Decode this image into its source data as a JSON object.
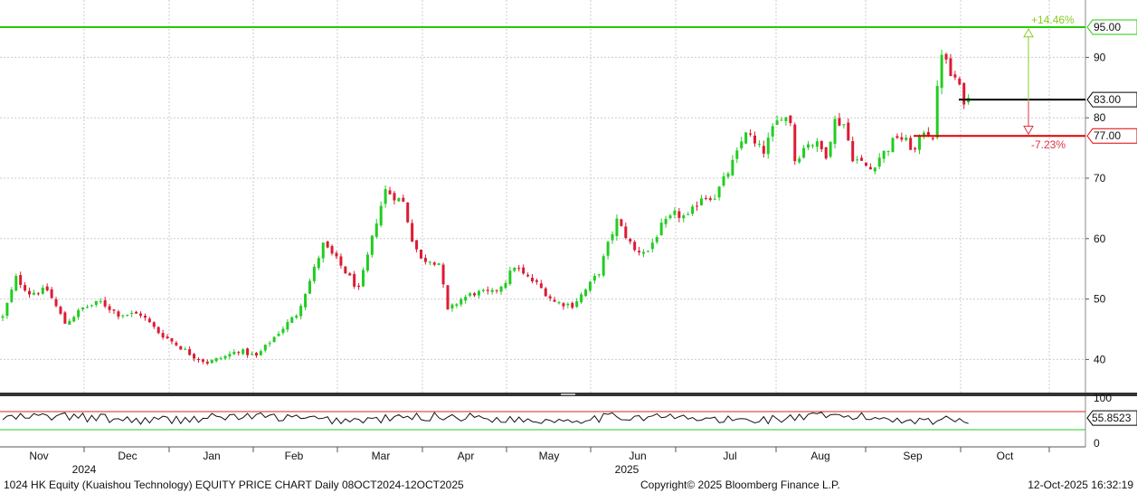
{
  "chart_data": {
    "type": "candlestick",
    "title": "1024 HK Equity (Kuaishou Technology) EQUITY PRICE CHART Daily 08OCT2024-12OCT2025",
    "x_range": [
      "2024-10-08",
      "2025-10-12"
    ],
    "price_axis": {
      "ylim": [
        33.5,
        97
      ],
      "ticks": [
        40,
        50,
        60,
        70,
        80,
        90
      ]
    },
    "x_tick_labels": [
      "Nov",
      "Dec",
      "Jan",
      "Feb",
      "Mar",
      "Apr",
      "May",
      "Jun",
      "Jul",
      "Aug",
      "Sep",
      "Oct"
    ],
    "year_labels": [
      "2024",
      "2025"
    ],
    "grid": true,
    "levels": {
      "upper_target": {
        "value": 95.0,
        "label": "95.00",
        "color": "#22cc00"
      },
      "last_price": {
        "value": 83.0,
        "label": "83.00",
        "color": "#000000"
      },
      "lower_target": {
        "value": 77.0,
        "label": "77.00",
        "color": "#dd0000"
      }
    },
    "annotations": {
      "upside_pct": "+14.46%",
      "downside_pct": "-7.23%"
    },
    "anchors": [
      [
        0,
        47
      ],
      [
        3,
        53.5
      ],
      [
        6,
        51
      ],
      [
        10,
        51.5
      ],
      [
        14,
        46
      ],
      [
        18,
        48.5
      ],
      [
        22,
        49.5
      ],
      [
        26,
        47.5
      ],
      [
        31,
        47.5
      ],
      [
        35,
        44.5
      ],
      [
        39,
        42.5
      ],
      [
        43,
        40.5
      ],
      [
        46,
        39.5
      ],
      [
        50,
        40.5
      ],
      [
        53,
        41.5
      ],
      [
        57,
        40.5
      ],
      [
        62,
        44.5
      ],
      [
        66,
        47.5
      ],
      [
        69,
        53
      ],
      [
        72,
        59
      ],
      [
        75,
        56.5
      ],
      [
        78,
        53.5
      ],
      [
        80,
        51.5
      ],
      [
        82,
        57
      ],
      [
        84,
        63
      ],
      [
        86,
        68
      ],
      [
        90,
        66
      ],
      [
        92,
        60
      ],
      [
        94,
        56.5
      ],
      [
        96,
        56.5
      ],
      [
        98,
        56
      ],
      [
        100,
        48
      ],
      [
        103,
        50
      ],
      [
        106,
        51
      ],
      [
        110,
        51
      ],
      [
        113,
        53
      ],
      [
        115,
        55.5
      ],
      [
        117,
        54
      ],
      [
        120,
        52.5
      ],
      [
        124,
        49.5
      ],
      [
        128,
        49
      ],
      [
        131,
        51.5
      ],
      [
        134,
        54.5
      ],
      [
        136,
        59
      ],
      [
        138,
        63
      ],
      [
        142,
        58
      ],
      [
        145,
        58
      ],
      [
        148,
        62
      ],
      [
        151,
        64
      ],
      [
        154,
        63.5
      ],
      [
        157,
        67
      ],
      [
        160,
        67
      ],
      [
        163,
        71
      ],
      [
        165,
        74
      ],
      [
        167,
        78
      ],
      [
        169,
        75.5
      ],
      [
        171,
        74.5
      ],
      [
        173,
        78
      ],
      [
        175,
        80.5
      ],
      [
        177,
        79.5
      ],
      [
        178,
        73
      ],
      [
        181,
        76
      ],
      [
        183,
        75.5
      ],
      [
        185,
        74
      ],
      [
        187,
        79.5
      ],
      [
        189,
        79
      ],
      [
        191,
        73.5
      ],
      [
        193,
        72.5
      ],
      [
        195,
        71.5
      ],
      [
        197,
        73.5
      ],
      [
        199,
        75
      ],
      [
        201,
        77
      ],
      [
        203,
        76
      ],
      [
        205,
        74.5
      ],
      [
        207,
        78
      ],
      [
        209,
        77
      ],
      [
        210,
        84.5
      ],
      [
        211,
        91
      ],
      [
        212,
        89
      ],
      [
        213,
        87
      ],
      [
        214,
        86.5
      ],
      [
        216,
        83
      ]
    ],
    "rsi": {
      "ylim": [
        0,
        100
      ],
      "ticks": [
        0,
        100
      ],
      "upper_line": 70,
      "lower_line": 30,
      "last_value": 55.8523,
      "last_label": "55.8523"
    }
  },
  "footer": {
    "title": "1024 HK Equity (Kuaishou Technology) EQUITY PRICE CHART Daily 08OCT2024-12OCT2025",
    "copyright": "Copyright© 2025 Bloomberg Finance L.P.",
    "timestamp": "12-Oct-2025 16:32:19"
  }
}
